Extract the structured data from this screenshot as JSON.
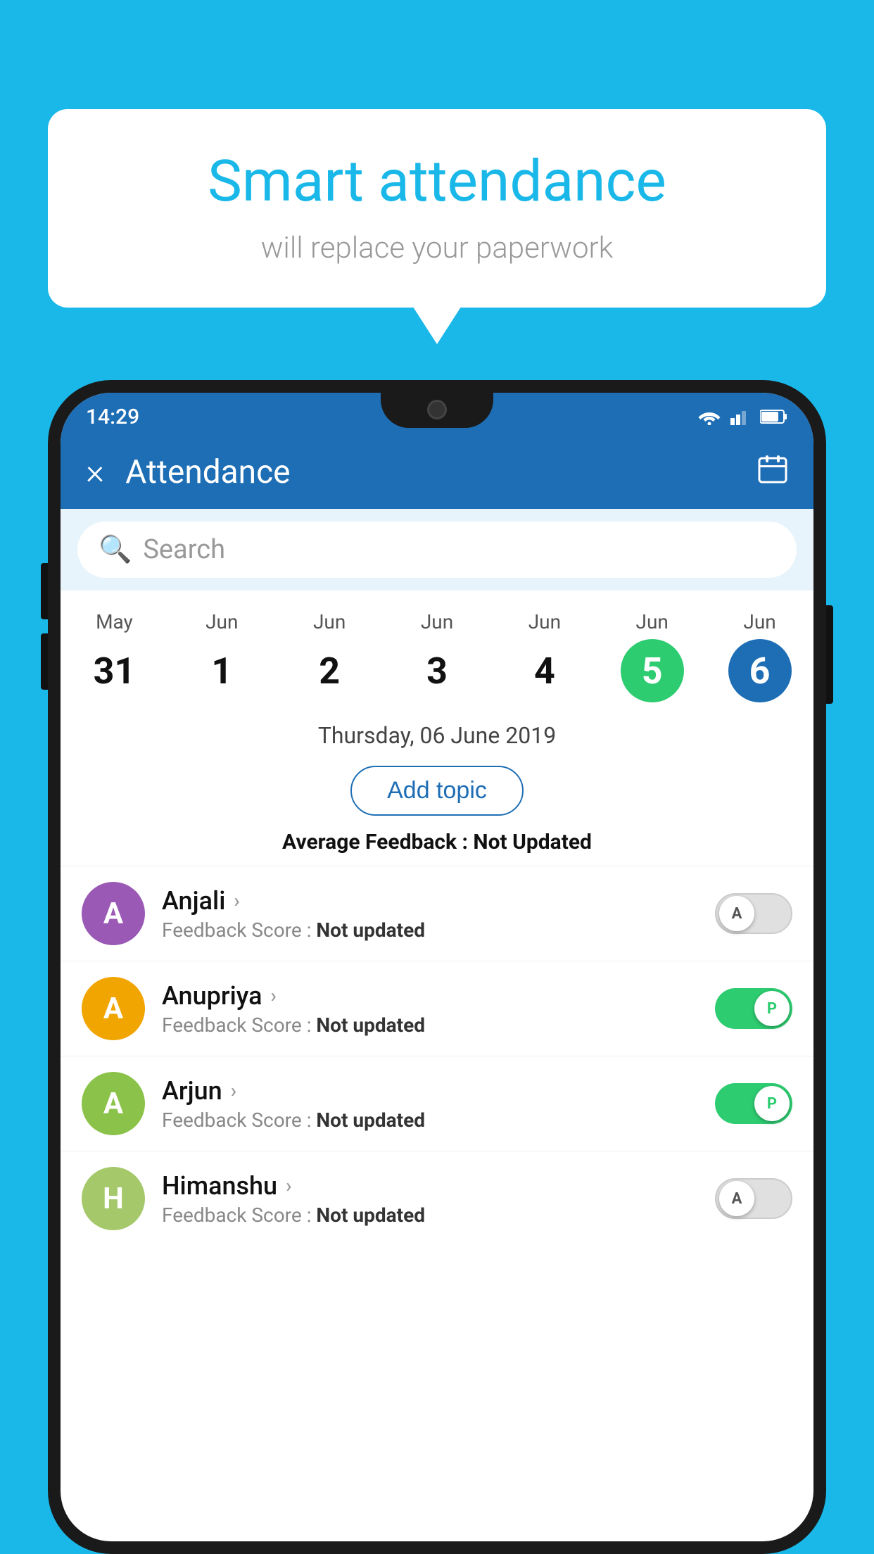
{
  "background_color": "#1ab8e8",
  "bubble": {
    "title": "Smart attendance",
    "subtitle": "will replace your paperwork"
  },
  "status_bar": {
    "time": "14:29"
  },
  "app_bar": {
    "title": "Attendance",
    "close_icon": "×",
    "calendar_icon": "📅"
  },
  "search": {
    "placeholder": "Search"
  },
  "calendar": {
    "columns": [
      {
        "month": "May",
        "day": "31",
        "style": "normal"
      },
      {
        "month": "Jun",
        "day": "1",
        "style": "normal"
      },
      {
        "month": "Jun",
        "day": "2",
        "style": "normal"
      },
      {
        "month": "Jun",
        "day": "3",
        "style": "normal"
      },
      {
        "month": "Jun",
        "day": "4",
        "style": "normal"
      },
      {
        "month": "Jun",
        "day": "5",
        "style": "green"
      },
      {
        "month": "Jun",
        "day": "6",
        "style": "blue"
      }
    ]
  },
  "selected_date": "Thursday, 06 June 2019",
  "add_topic_label": "Add topic",
  "avg_feedback": {
    "label": "Average Feedback : ",
    "value": "Not Updated"
  },
  "students": [
    {
      "name": "Anjali",
      "avatar_letter": "A",
      "avatar_color": "#9b59b6",
      "feedback_label": "Feedback Score : ",
      "feedback_value": "Not updated",
      "toggle": "off",
      "toggle_letter": "A"
    },
    {
      "name": "Anupriya",
      "avatar_letter": "A",
      "avatar_color": "#f0a500",
      "feedback_label": "Feedback Score : ",
      "feedback_value": "Not updated",
      "toggle": "on",
      "toggle_letter": "P"
    },
    {
      "name": "Arjun",
      "avatar_letter": "A",
      "avatar_color": "#8bc34a",
      "feedback_label": "Feedback Score : ",
      "feedback_value": "Not updated",
      "toggle": "on",
      "toggle_letter": "P"
    },
    {
      "name": "Himanshu",
      "avatar_letter": "H",
      "avatar_color": "#a5c96a",
      "feedback_label": "Feedback Score : ",
      "feedback_value": "Not updated",
      "toggle": "off",
      "toggle_letter": "A"
    }
  ]
}
